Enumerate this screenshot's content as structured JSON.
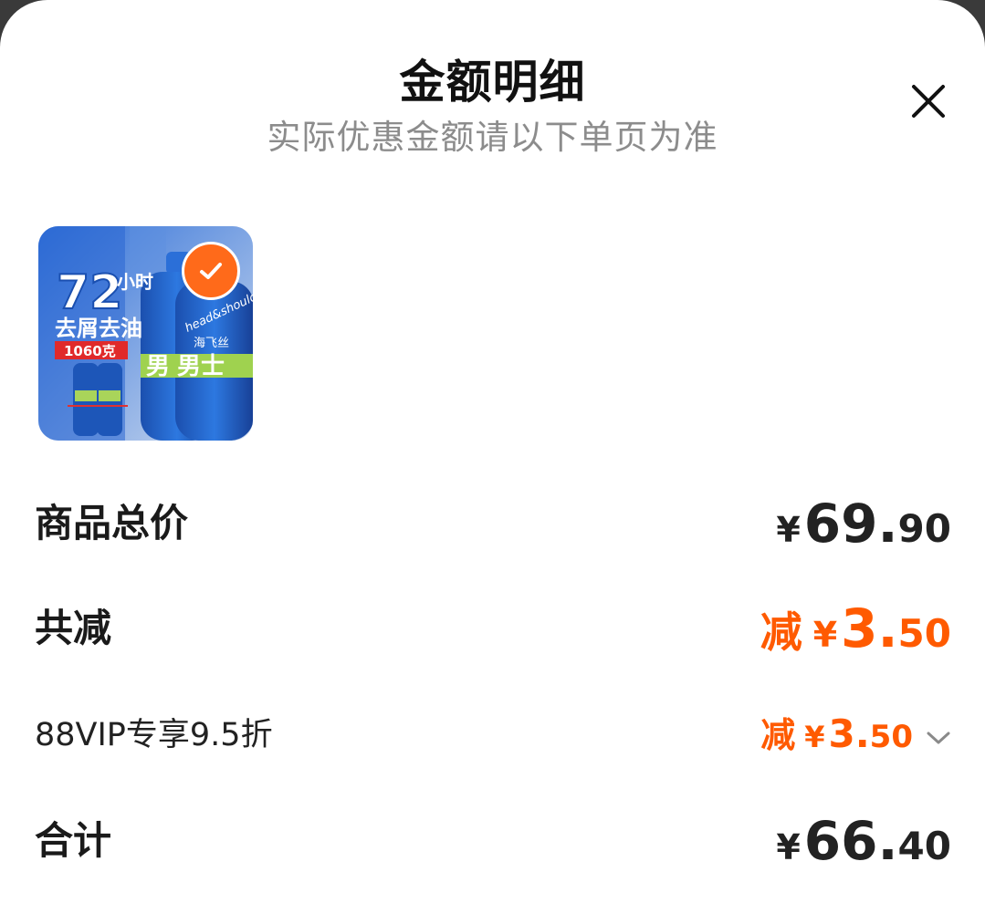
{
  "header": {
    "title": "金额明细",
    "subtitle": "实际优惠金额请以下单页为准",
    "close_icon": "close-icon"
  },
  "product": {
    "image_text": {
      "hours": "72",
      "hours_unit": "小时",
      "headline": "去屑去油",
      "weight": "1060克",
      "brand": "head&shoulders",
      "brand_cn": "海飞丝",
      "bottle_label": "男士"
    },
    "selected_icon": "check-icon"
  },
  "summary": {
    "total_price": {
      "label": "商品总价",
      "currency": "¥",
      "integer": "69.",
      "decimal": "90"
    },
    "discount": {
      "label": "共减",
      "prefix": "减",
      "currency": "¥",
      "integer": "3.",
      "decimal": "50"
    },
    "vip_discount": {
      "label": "88VIP专享9.5折",
      "prefix": "减",
      "currency": "¥",
      "integer": "3.",
      "decimal": "50",
      "expand_icon": "chevron-down-icon"
    },
    "grand_total": {
      "label": "合计",
      "currency": "¥",
      "integer": "66.",
      "decimal": "40"
    }
  },
  "colors": {
    "accent_orange": "#ff5a00",
    "text_dark": "#222222",
    "text_muted": "#8c8c8c",
    "product_blue": "#1a5fc8"
  }
}
